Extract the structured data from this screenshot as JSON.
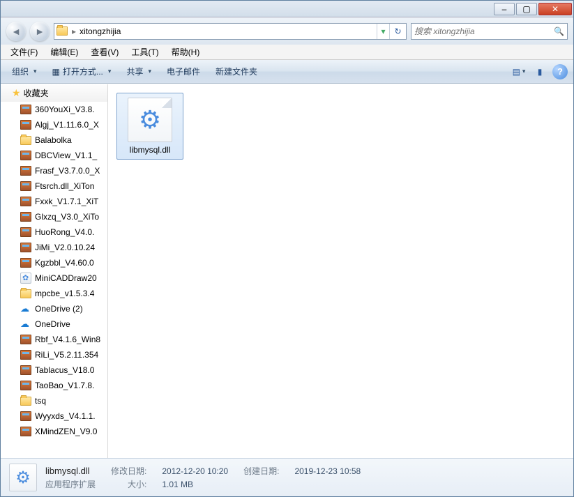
{
  "titlebar": {
    "min": "–",
    "max": "▢",
    "close": "✕"
  },
  "nav": {
    "path": "xitongzhijia"
  },
  "search": {
    "placeholder": "搜索 xitongzhijia",
    "icon": "🔍"
  },
  "menu": {
    "file": "文件(F)",
    "edit": "编辑(E)",
    "view": "查看(V)",
    "tools": "工具(T)",
    "help": "帮助(H)"
  },
  "toolbar": {
    "organize": "组织",
    "openwith": "打开方式...",
    "share": "共享",
    "email": "电子邮件",
    "newfolder": "新建文件夹"
  },
  "sidebar": {
    "fav": "收藏夹",
    "items": [
      {
        "icon": "rar",
        "label": "360YouXi_V3.8."
      },
      {
        "icon": "rar",
        "label": "Algj_V1.11.6.0_X"
      },
      {
        "icon": "folder",
        "label": "Balabolka"
      },
      {
        "icon": "rar",
        "label": "DBCView_V1.1_"
      },
      {
        "icon": "rar",
        "label": "Frasf_V3.7.0.0_X"
      },
      {
        "icon": "rar",
        "label": "Ftsrch.dll_XiTon"
      },
      {
        "icon": "rar",
        "label": "Fxxk_V1.7.1_XiT"
      },
      {
        "icon": "rar",
        "label": "Glxzq_V3.0_XiTo"
      },
      {
        "icon": "rar",
        "label": "HuoRong_V4.0."
      },
      {
        "icon": "rar",
        "label": "JiMi_V2.0.10.24"
      },
      {
        "icon": "rar",
        "label": "Kgzbbl_V4.60.0"
      },
      {
        "icon": "app",
        "label": "MiniCADDraw20"
      },
      {
        "icon": "folder",
        "label": "mpcbe_v1.5.3.4"
      },
      {
        "icon": "cloud",
        "label": "OneDrive (2)"
      },
      {
        "icon": "cloud",
        "label": "OneDrive"
      },
      {
        "icon": "rar",
        "label": "Rbf_V4.1.6_Win8"
      },
      {
        "icon": "rar",
        "label": "RiLi_V5.2.11.354"
      },
      {
        "icon": "rar",
        "label": "Tablacus_V18.0"
      },
      {
        "icon": "rar",
        "label": "TaoBao_V1.7.8."
      },
      {
        "icon": "folder",
        "label": "tsq"
      },
      {
        "icon": "rar",
        "label": "Wyyxds_V4.1.1."
      },
      {
        "icon": "rar",
        "label": "XMindZEN_V9.0"
      }
    ]
  },
  "main": {
    "items": [
      {
        "name": "libmysql.dll"
      }
    ]
  },
  "details": {
    "name": "libmysql.dll",
    "type": "应用程序扩展",
    "modLabel": "修改日期:",
    "modVal": "2012-12-20 10:20",
    "createLabel": "创建日期:",
    "createVal": "2019-12-23 10:58",
    "sizeLabel": "大小:",
    "sizeVal": "1.01 MB"
  }
}
